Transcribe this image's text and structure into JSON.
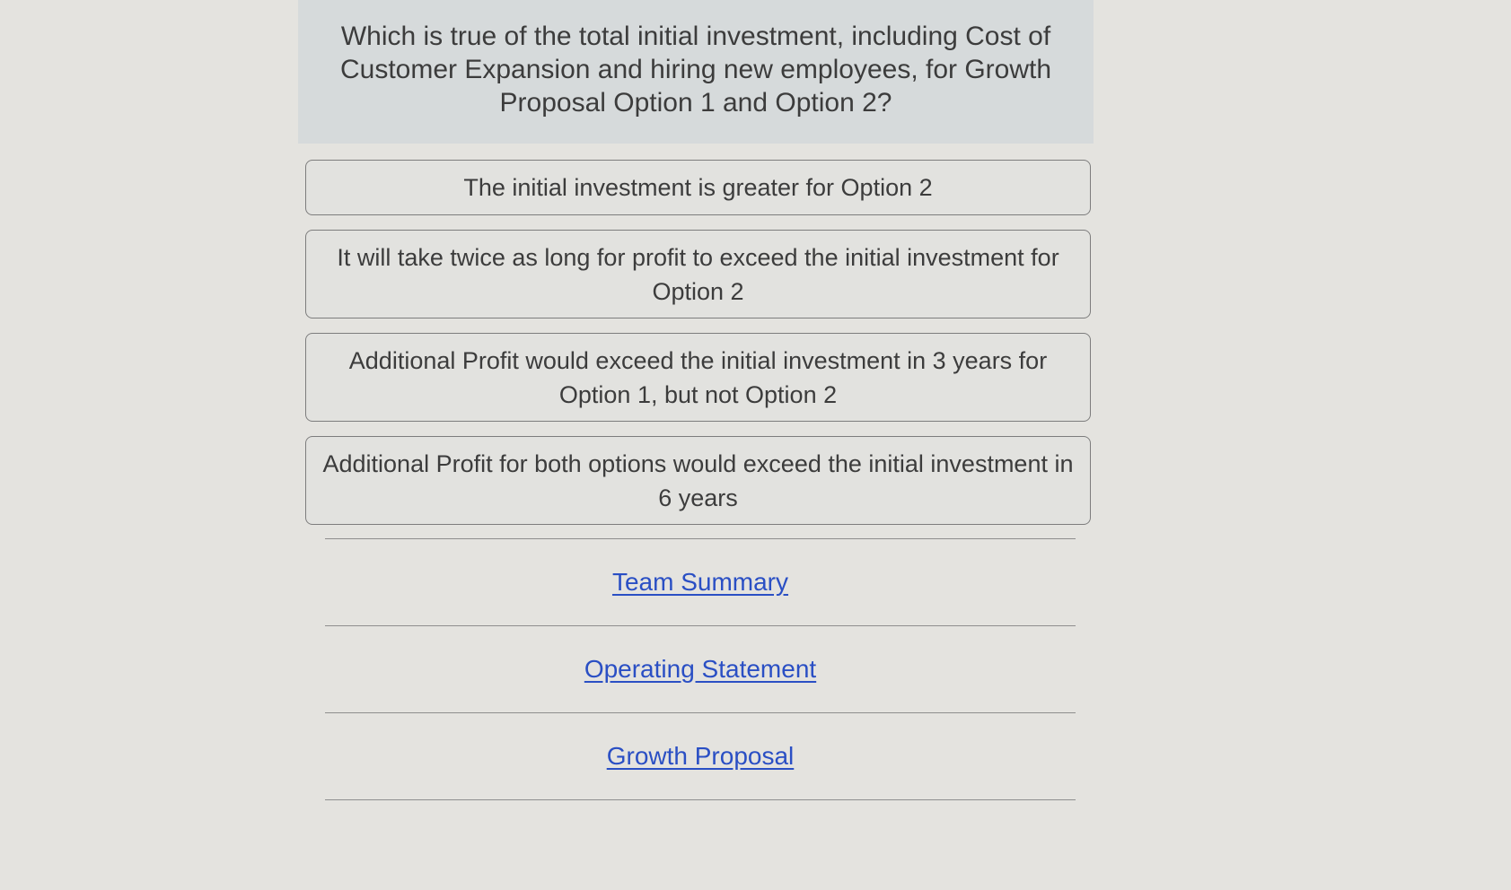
{
  "question": {
    "text": "Which is true of the total initial investment, including Cost of Customer Expansion and hiring new employees, for Growth Proposal Option 1 and Option 2?"
  },
  "options": [
    {
      "label": "The initial investment is greater for Option 2"
    },
    {
      "label": "It will take twice as long for profit to exceed the initial investment for Option 2"
    },
    {
      "label": "Additional Profit would exceed the initial investment in 3 years for Option 1, but not Option 2"
    },
    {
      "label": "Additional Profit for both options would exceed the initial investment in 6 years"
    }
  ],
  "nav_links": [
    {
      "label": "Team Summary"
    },
    {
      "label": "Operating Statement"
    },
    {
      "label": "Growth Proposal"
    }
  ],
  "colors": {
    "background": "#e4e3df",
    "question_background": "#d6dadb",
    "link": "#2a4fc4"
  }
}
